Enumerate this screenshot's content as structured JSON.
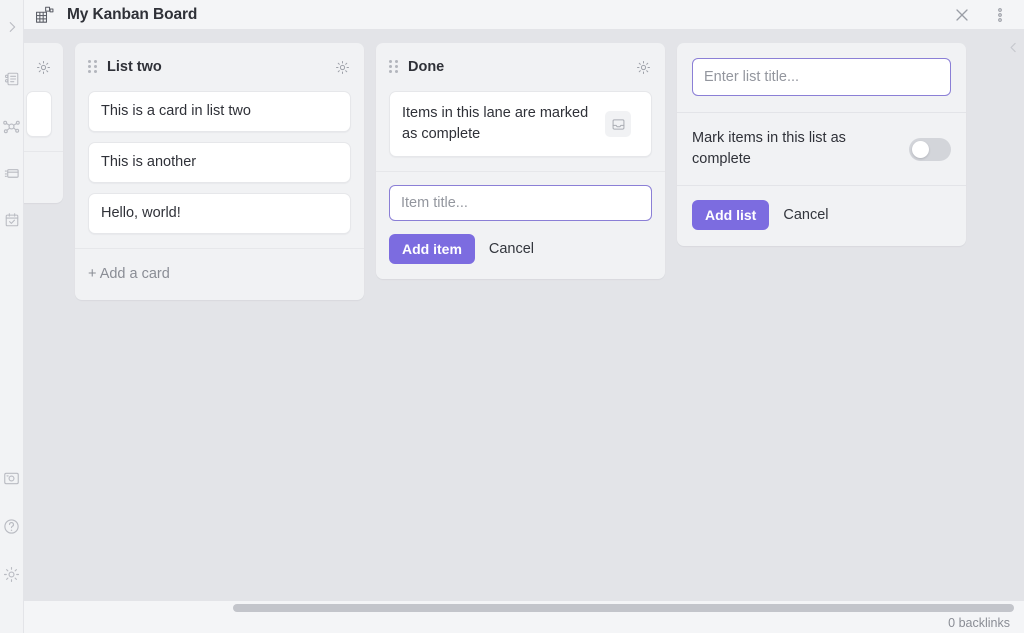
{
  "window": {
    "title": "My Kanban Board",
    "app_icon": "kanban-grid-icon",
    "close_label": "✕",
    "more_label": "more-options"
  },
  "rail": {
    "items": [
      {
        "icon": "chevron-right-icon",
        "name": "expand-sidebar"
      },
      {
        "icon": "notes-icon",
        "name": "notes"
      },
      {
        "icon": "graph-icon",
        "name": "graph-view"
      },
      {
        "icon": "cards-icon",
        "name": "cards"
      },
      {
        "icon": "calendar-check-icon",
        "name": "calendar"
      },
      {
        "icon": "screenshot-icon",
        "name": "capture"
      },
      {
        "icon": "help-icon",
        "name": "help"
      },
      {
        "icon": "settings-gear-icon",
        "name": "settings"
      }
    ]
  },
  "board": {
    "lists": [
      {
        "title": "",
        "clipped": true,
        "cards": [],
        "add_card_label": ""
      },
      {
        "title": "List two",
        "clipped": false,
        "cards": [
          {
            "text": "This is a card in list two",
            "badge": null
          },
          {
            "text": "This is another",
            "badge": null
          },
          {
            "text": "Hello, world!",
            "badge": null
          }
        ],
        "add_card_label": "+ Add a card"
      },
      {
        "title": "Done",
        "clipped": false,
        "cards": [
          {
            "text": "Items in this lane are marked as complete",
            "badge": "archive-tray-icon"
          }
        ],
        "composer": {
          "placeholder": "Item title...",
          "value": "",
          "submit_label": "Add item",
          "cancel_label": "Cancel"
        }
      }
    ],
    "add_list": {
      "placeholder": "Enter list title...",
      "value": "",
      "toggle_label": "Mark items in this list as complete",
      "toggle_on": false,
      "submit_label": "Add list",
      "cancel_label": "Cancel"
    }
  },
  "status": {
    "backlinks": "0 backlinks"
  },
  "colors": {
    "accent_purple": "#7c6ce0",
    "board_background": "#e3e4e8",
    "list_background": "#f1f2f4",
    "card_background": "#ffffff",
    "text_primary": "#2f3138",
    "text_muted": "#8a8d95"
  }
}
